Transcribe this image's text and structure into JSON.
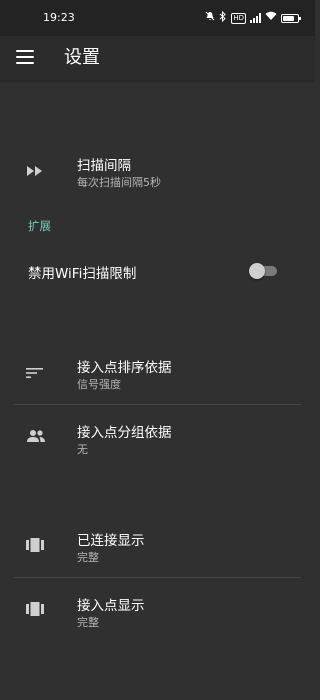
{
  "status_bar": {
    "time": "19:23",
    "network_badge": "HD",
    "battery_level": 0.75
  },
  "app_bar": {
    "title": "设置",
    "menu_icon": "menu-icon"
  },
  "scan_interval": {
    "title": "扫描间隔",
    "summary": "每次扫描间隔5秒",
    "icon": "fast-forward-icon"
  },
  "section_extension": {
    "header": "扩展",
    "header_color": "#7cc7bd"
  },
  "wifi_throttle": {
    "label": "禁用WiFi扫描限制",
    "enabled": false
  },
  "ap_sort": {
    "title": "接入点排序依据",
    "summary": "信号强度",
    "icon": "sort-icon"
  },
  "ap_group": {
    "title": "接入点分组依据",
    "summary": "无",
    "icon": "group-icon"
  },
  "connected_display": {
    "title": "已连接显示",
    "summary": "完整",
    "icon": "view-carousel-icon"
  },
  "ap_display": {
    "title": "接入点显示",
    "summary": "完整",
    "icon": "view-carousel-icon"
  }
}
